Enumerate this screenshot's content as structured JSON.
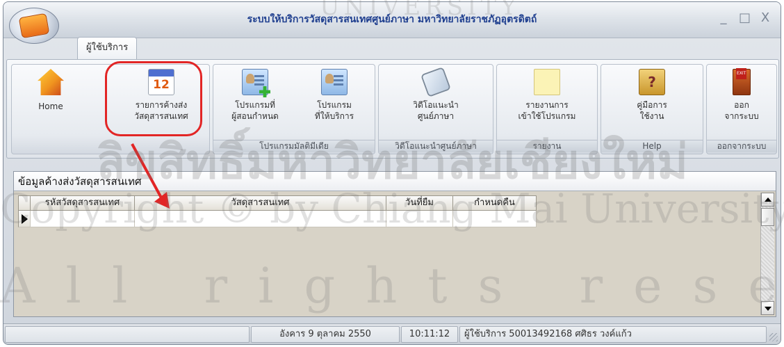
{
  "window": {
    "title": "ระบบให้บริการวัสดุสารสนเทศศูนย์ภาษา มหาวิทยาลัยราชภัฏอุตรดิตถ์",
    "controls": [
      "_",
      "□",
      "X"
    ]
  },
  "ribbon": {
    "tab": "ผู้ใช้บริการ",
    "buttons": {
      "home": {
        "l1": "Home",
        "l2": "",
        "icon": "home-icon"
      },
      "pending": {
        "l1": "รายการค้างส่ง",
        "l2": "วัสดุสารสนเทศ",
        "icon": "calendar-icon",
        "cal_day": "12"
      },
      "teacher_program": {
        "l1": "โปรแกรมที่",
        "l2": "ผู้สอนกำหนด",
        "icon": "user-add-icon"
      },
      "service_program": {
        "l1": "โปรแกรม",
        "l2": "ที่ให้บริการ",
        "icon": "user-card-icon"
      },
      "video": {
        "l1": "วิดีโอแนะนำ",
        "l2": "ศูนย์ภาษา",
        "icon": "film-icon"
      },
      "report": {
        "l1": "รายงานการ",
        "l2": "เข้าใช้โปรแกรม",
        "icon": "document-icon"
      },
      "manual": {
        "l1": "คู่มือการ",
        "l2": "ใช้งาน",
        "icon": "help-book-icon",
        "glyph": "?"
      },
      "exit": {
        "l1": "ออก",
        "l2": "จากระบบ",
        "icon": "exit-door-icon"
      }
    },
    "groups": {
      "multimedia": "โปรแกรมมัลติมีเดีย",
      "video": "วิดีโอแนะนำศูนย์ภาษา",
      "report": "รายงาน",
      "help": "Help",
      "exit": "ออกจากระบบ"
    }
  },
  "panel": {
    "title": "ข้อมูลค้างส่งวัสดุสารสนเทศ",
    "columns": [
      "รหัสวัสดุสารสนเทศ",
      "วัสดุสารสนเทศ",
      "วันที่ยืม",
      "กำหนดคืน"
    ]
  },
  "status": {
    "date": "อังคาร 9 ตุลาคม 2550",
    "time": "10:11:12",
    "user": "ผู้ใช้บริการ 50013492168 ศศิธร วงค์แก้ว"
  },
  "watermark": {
    "top": "UNIVERSITY",
    "line1": "ลิขสิทธิ์มหาวิทยาลัยเชียงใหม่",
    "line2": "Copyright © by Chiang Mai University",
    "line3": "All rights reserved"
  },
  "colors": {
    "title": "#1f3f8f",
    "callout": "#e22525",
    "panel_bg": "#d8d3c7"
  }
}
